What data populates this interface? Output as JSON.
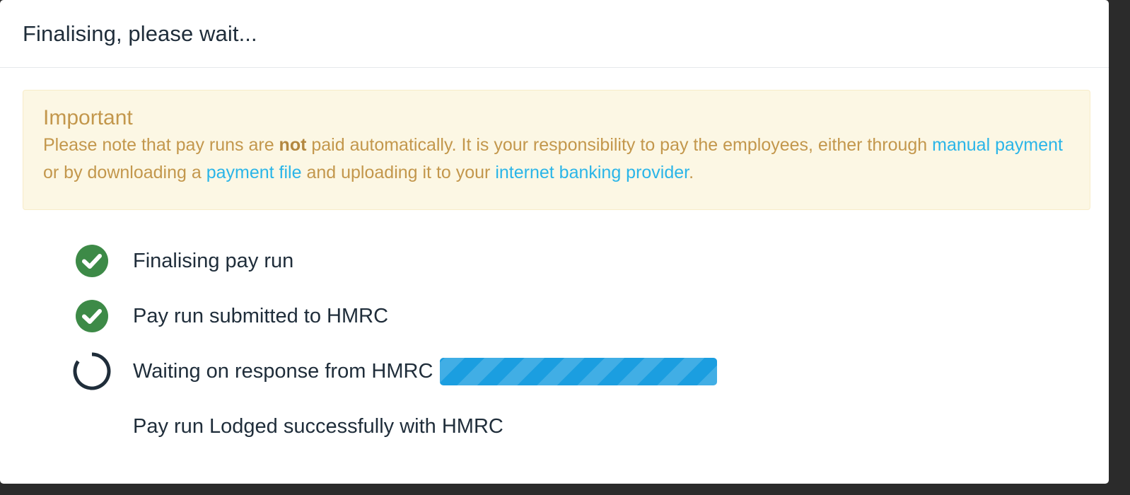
{
  "modal": {
    "title": "Finalising, please wait..."
  },
  "alert": {
    "heading": "Important",
    "text_part1": "Please note that pay runs are ",
    "text_bold": "not",
    "text_part2": " paid automatically. It is your responsibility to pay the employees, either through ",
    "link_manual_payment": "manual payment",
    "text_part3": " or by downloading a ",
    "link_payment_file": "payment file",
    "text_part4": " and uploading it to your ",
    "link_banking_provider": "internet banking provider",
    "text_part5": "."
  },
  "steps": [
    {
      "label": "Finalising pay run",
      "status": "complete",
      "icon": "check-circle-icon"
    },
    {
      "label": "Pay run submitted to HMRC",
      "status": "complete",
      "icon": "check-circle-icon"
    },
    {
      "label": "Waiting on response from HMRC",
      "status": "in-progress",
      "icon": "spinner-icon",
      "progress": 1.0
    },
    {
      "label": "Pay run Lodged successfully with HMRC",
      "status": "pending",
      "icon": ""
    }
  ],
  "colors": {
    "success": "#3d8a47",
    "spinner": "#1f2d3a",
    "progress": "#1b9ee0",
    "alert_text": "#c3974c",
    "link": "#2ab5e8",
    "alert_bg": "#fcf7e4"
  }
}
